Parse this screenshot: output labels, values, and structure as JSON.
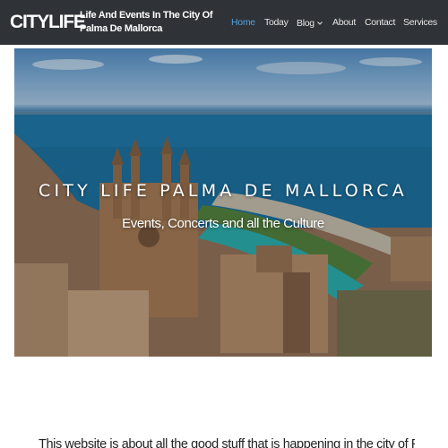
{
  "header": {
    "logo": "CITYLIFE",
    "tagline": "Life And Events In The City Of Palma De Mallorca",
    "nav": [
      {
        "label": "Home",
        "active": true
      },
      {
        "label": "Today",
        "active": false
      },
      {
        "label": "Blog",
        "active": false,
        "dropdown": true
      },
      {
        "label": "About",
        "active": false
      },
      {
        "label": "Contact",
        "active": false
      },
      {
        "label": "Services",
        "active": false
      }
    ]
  },
  "hero": {
    "title": "CITY LIFE PALMA DE MALLORCA",
    "subtitle": "Events, Concerts and all the Culture"
  },
  "intro": {
    "text": "This website is about all the good stuff that is happening in the city of Pal"
  },
  "colors": {
    "header_bg": "#2f3236",
    "nav_active": "#4fa3e3",
    "nav_text": "#e6e6e6"
  },
  "icons": {
    "blog_dropdown": "chevron-down-icon"
  }
}
